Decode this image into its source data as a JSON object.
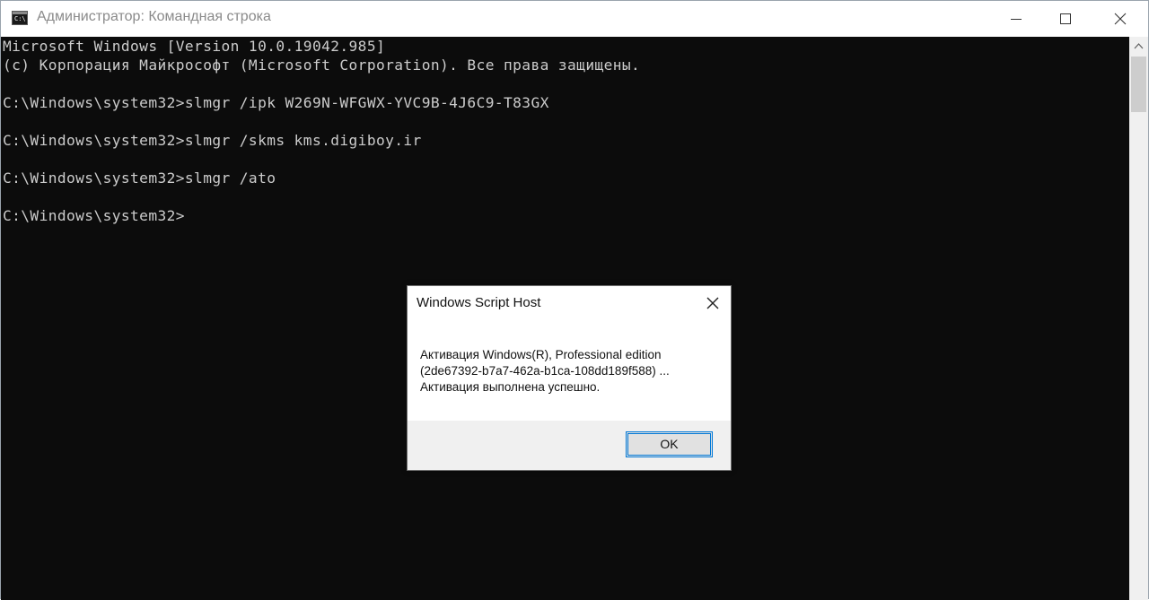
{
  "window": {
    "title": "Администратор: Командная строка",
    "app_icon_text": "C:\\",
    "controls": {
      "minimize": "minimize-icon",
      "maximize": "maximize-icon",
      "close": "close-icon"
    }
  },
  "console": {
    "lines": [
      "Microsoft Windows [Version 10.0.19042.985]",
      "(c) Корпорация Майкрософт (Microsoft Corporation). Все права защищены.",
      "",
      "C:\\Windows\\system32>slmgr /ipk W269N-WFGWX-YVC9B-4J6C9-T83GX",
      "",
      "C:\\Windows\\system32>slmgr /skms kms.digiboy.ir",
      "",
      "C:\\Windows\\system32>slmgr /ato",
      "",
      "C:\\Windows\\system32>"
    ]
  },
  "dialog": {
    "title": "Windows Script Host",
    "message_lines": [
      "Активация Windows(R), Professional edition",
      "(2de67392-b7a7-462a-b1ca-108dd189f588) ...",
      "Активация выполнена успешно."
    ],
    "ok_label": "OK"
  },
  "colors": {
    "console_bg": "#0c0c0c",
    "console_text": "#cccccc",
    "accent": "#0078d7"
  }
}
